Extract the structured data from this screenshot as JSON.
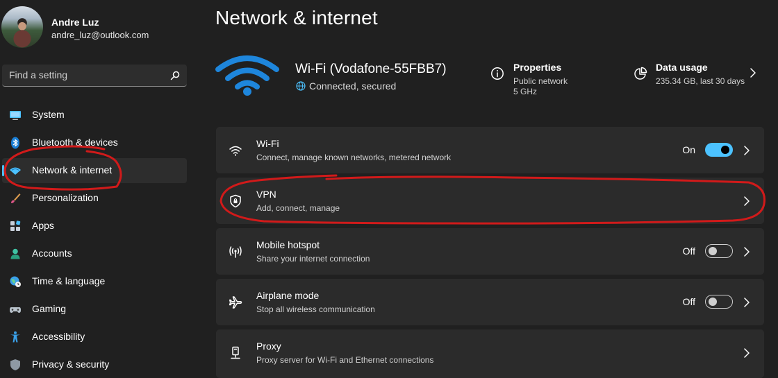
{
  "profile": {
    "name": "Andre Luz",
    "email": "andre_luz@outlook.com"
  },
  "search": {
    "placeholder": "Find a setting"
  },
  "sidebar": {
    "items": [
      {
        "label": "System",
        "icon": "monitor-icon"
      },
      {
        "label": "Bluetooth & devices",
        "icon": "bluetooth-icon"
      },
      {
        "label": "Network & internet",
        "icon": "wifi-diamond-icon",
        "selected": true
      },
      {
        "label": "Personalization",
        "icon": "brush-icon"
      },
      {
        "label": "Apps",
        "icon": "apps-icon"
      },
      {
        "label": "Accounts",
        "icon": "person-icon"
      },
      {
        "label": "Time & language",
        "icon": "globe-clock-icon"
      },
      {
        "label": "Gaming",
        "icon": "gamepad-icon"
      },
      {
        "label": "Accessibility",
        "icon": "accessibility-icon"
      },
      {
        "label": "Privacy & security",
        "icon": "shield-icon"
      }
    ]
  },
  "main": {
    "title": "Network & internet",
    "hero": {
      "title": "Wi-Fi (Vodafone-55FBB7)",
      "status": "Connected, secured",
      "properties": {
        "title": "Properties",
        "line1": "Public network",
        "line2": "5 GHz"
      },
      "usage": {
        "title": "Data usage",
        "detail": "235.34 GB, last 30 days"
      }
    },
    "cards": [
      {
        "title": "Wi-Fi",
        "subtitle": "Connect, manage known networks, metered network",
        "icon": "wifi-icon",
        "toggle": "On"
      },
      {
        "title": "VPN",
        "subtitle": "Add, connect, manage",
        "icon": "vpn-shield-icon"
      },
      {
        "title": "Mobile hotspot",
        "subtitle": "Share your internet connection",
        "icon": "hotspot-icon",
        "toggle": "Off"
      },
      {
        "title": "Airplane mode",
        "subtitle": "Stop all wireless communication",
        "icon": "airplane-icon",
        "toggle": "Off"
      },
      {
        "title": "Proxy",
        "subtitle": "Proxy server for Wi-Fi and Ethernet connections",
        "icon": "proxy-icon"
      }
    ]
  },
  "colors": {
    "background": "#202020",
    "card": "#2b2b2b",
    "accent": "#4cc2ff",
    "annotation": "#d11a1a"
  }
}
